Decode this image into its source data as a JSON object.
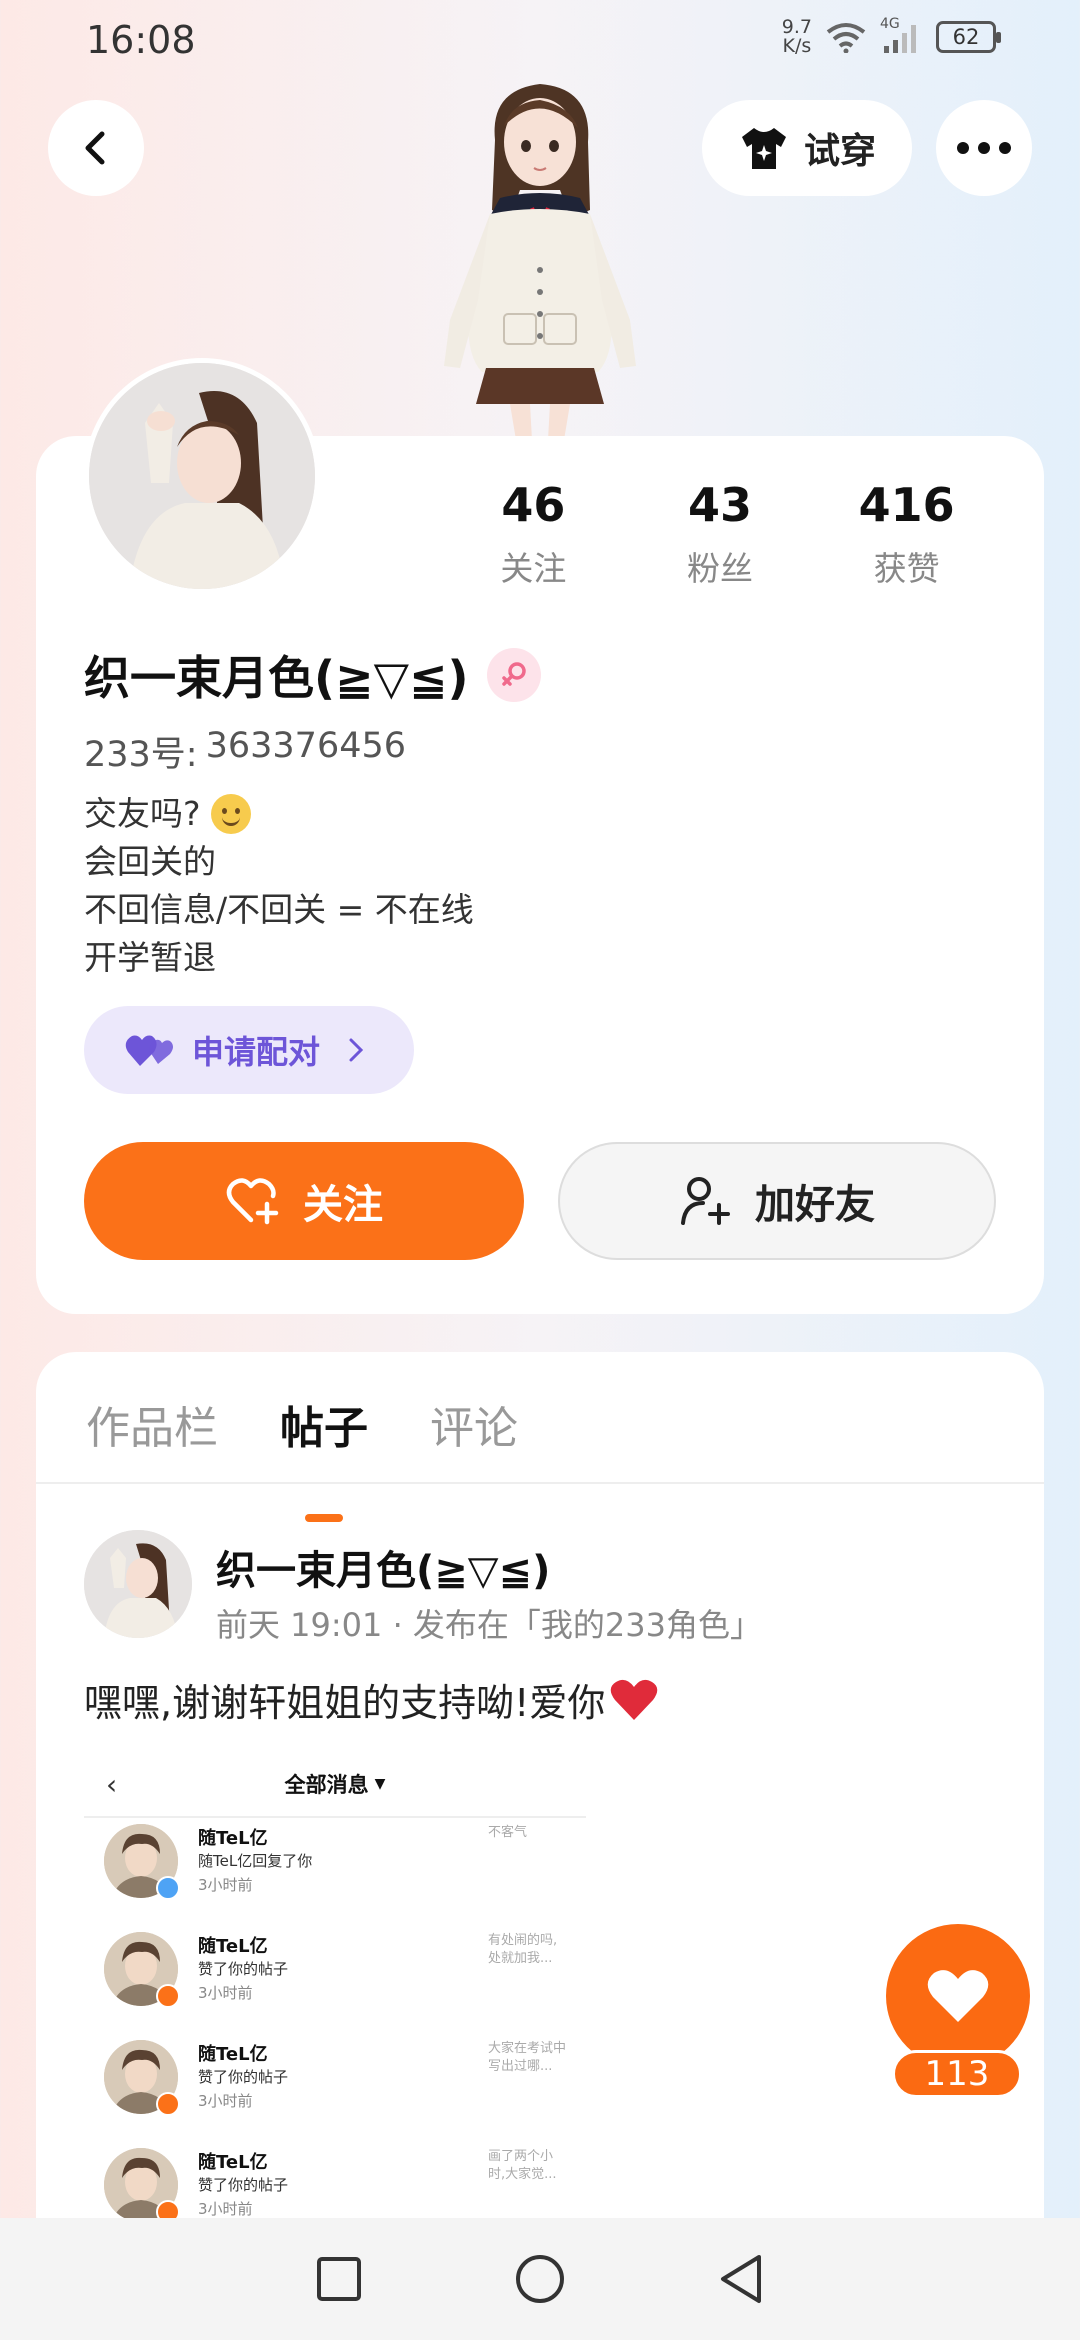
{
  "status_bar": {
    "time": "16:08",
    "net_speed_value": "9.7",
    "net_speed_unit": "K/s",
    "network": "4G",
    "battery": "62"
  },
  "header": {
    "try_on_label": "试穿"
  },
  "profile": {
    "stats": [
      {
        "num": "46",
        "label": "关注"
      },
      {
        "num": "43",
        "label": "粉丝"
      },
      {
        "num": "416",
        "label": "获赞"
      }
    ],
    "nickname": "织一束月色(≧▽≦)",
    "uid_label": "233号:",
    "uid_value": "363376456",
    "bio_lines": [
      "交友吗?",
      "会回关的",
      "不回信息/不回关 = 不在线",
      "开学暂退"
    ],
    "pair_label": "申请配对",
    "follow_label": "关注",
    "add_friend_label": "加好友"
  },
  "tabs": [
    {
      "label": "作品栏"
    },
    {
      "label": "帖子"
    },
    {
      "label": "评论"
    }
  ],
  "post": {
    "author": "织一束月色(≧▽≦)",
    "meta": "前天 19:01 · 发布在「我的233角色」",
    "text": "嘿嘿,谢谢轩姐姐的支持呦!爱你",
    "image": {
      "header_title": "全部消息",
      "rows": [
        {
          "name": "随TeL亿",
          "action": "随TeL亿回复了你",
          "time": "3小时前",
          "side": "不客气",
          "badge": "comment"
        },
        {
          "name": "随TeL亿",
          "action": "赞了你的帖子",
          "time": "3小时前",
          "side": "有处闹的吗,处就加我...",
          "badge": "like"
        },
        {
          "name": "随TeL亿",
          "action": "赞了你的帖子",
          "time": "3小时前",
          "side": "大家在考试中写出过哪...",
          "badge": "like"
        },
        {
          "name": "随TeL亿",
          "action": "赞了你的帖子",
          "time": "3小时前",
          "side": "画了两个小时,大家觉...",
          "badge": "like"
        }
      ]
    }
  },
  "like_count": "113",
  "colors": {
    "accent": "#fb7118",
    "pair_purple": "#6d55d8",
    "gender_pink": "#f06a8c"
  }
}
